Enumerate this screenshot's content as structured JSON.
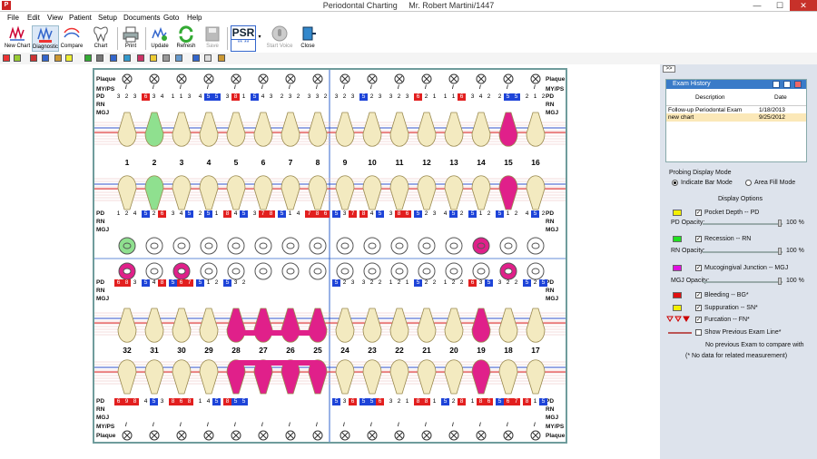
{
  "window": {
    "title": "Periodontal Charting",
    "patient": "Mr. Robert Martini/1447",
    "close_glyph": "✕",
    "min_glyph": "—",
    "max_glyph": "☐",
    "app_glyph": "P"
  },
  "menus": [
    "File",
    "Edit",
    "View",
    "Patient",
    "Setup",
    "Documents",
    "Goto",
    "Help"
  ],
  "toolbar": {
    "new_chart": "New Chart",
    "diagnostic": "Diagnostic",
    "compare": "Compare",
    "chart": "Chart",
    "print": "Print",
    "update": "Update",
    "refresh": "Refresh",
    "save": "Save",
    "psr": "PSR",
    "psr_marks": "** **",
    "start_voice": "Start Voice",
    "close": "Close"
  },
  "chart": {
    "row_labels": {
      "plaque": "Plaque",
      "myps": "MY/PS",
      "pd": "PD",
      "rn": "RN",
      "mgj": "MGJ"
    },
    "upper_teeth": [
      "1",
      "2",
      "3",
      "4",
      "5",
      "6",
      "7",
      "8",
      "9",
      "10",
      "11",
      "12",
      "13",
      "14",
      "15",
      "16"
    ],
    "lower_teeth": [
      "32",
      "31",
      "30",
      "29",
      "28",
      "27",
      "26",
      "25",
      "24",
      "23",
      "22",
      "21",
      "20",
      "19",
      "18",
      "17"
    ],
    "upper_buccal_pd": [
      "3",
      "2",
      "3",
      "6",
      "3",
      "4",
      "1",
      "1",
      "3",
      "4",
      "5",
      "5",
      "3",
      "8",
      "1",
      "5",
      "4",
      "3",
      "2",
      "3",
      "2",
      "3",
      "3",
      "2",
      "3",
      "2",
      "3",
      "5",
      "2",
      "3",
      "3",
      "2",
      "3",
      "6",
      "2",
      "1",
      "1",
      "1",
      "6",
      "3",
      "4",
      "2",
      "2",
      "5",
      "5",
      "2",
      "1",
      "2"
    ],
    "upper_lingual_pd": [
      "1",
      "2",
      "4",
      "5",
      "2",
      "6",
      "3",
      "4",
      "5",
      "2",
      "5",
      "1",
      "8",
      "4",
      "5",
      "3",
      "7",
      "8",
      "5",
      "1",
      "4",
      "7",
      "8",
      "6",
      "5",
      "3",
      "7",
      "8",
      "4",
      "5",
      "3",
      "8",
      "6",
      "5",
      "2",
      "3",
      "4",
      "5",
      "2",
      "5",
      "1",
      "2",
      "5",
      "1",
      "2",
      "4",
      "5",
      "2"
    ],
    "lower_lingual_pd": [
      "6",
      "8",
      "3",
      "5",
      "4",
      "8",
      "5",
      "6",
      "7",
      "5",
      "1",
      "2",
      "5",
      "3",
      "2",
      "",
      "",
      "",
      "",
      "",
      "",
      "",
      "",
      "",
      "5",
      "2",
      "3",
      "3",
      "2",
      "2",
      "1",
      "2",
      "1",
      "5",
      "2",
      "2",
      "1",
      "2",
      "2",
      "6",
      "3",
      "5",
      "3",
      "2",
      "2",
      "5",
      "2",
      "5"
    ],
    "lower_buccal_pd": [
      "6",
      "9",
      "8",
      "4",
      "5",
      "3",
      "8",
      "6",
      "8",
      "1",
      "4",
      "5",
      "8",
      "5",
      "5",
      "",
      "",
      "",
      "",
      "",
      "",
      "",
      "",
      "",
      "5",
      "3",
      "6",
      "5",
      "5",
      "6",
      "3",
      "2",
      "1",
      "8",
      "8",
      "1",
      "5",
      "2",
      "8",
      "1",
      "8",
      "6",
      "5",
      "6",
      "7",
      "8",
      "1",
      "5"
    ],
    "mark": "/"
  },
  "exam_history": {
    "title": "Exam History",
    "col_description": "Description",
    "col_date": "Date",
    "rows": [
      {
        "description": "Follow-up Periodontal Exam",
        "date": "1/18/2013"
      },
      {
        "description": "new chart",
        "date": "9/25/2012"
      }
    ]
  },
  "probing": {
    "title": "Probing Display Mode",
    "indicate_bar": "Indicate Bar Mode",
    "area_fill": "Area Fill Mode",
    "selected": "indicate_bar"
  },
  "display_options": {
    "title": "Display Options",
    "pocket_depth": "Pocket Depth -- PD",
    "pd_opacity": "PD Opacity:",
    "pd_opacity_val": "100 %",
    "recession": "Recession -- RN",
    "rn_opacity": "RN Opacity:",
    "rn_opacity_val": "100 %",
    "mgj": "Mucogingival Junction -- MGJ",
    "mgj_opacity": "MGJ Opacity:",
    "mgj_opacity_val": "100 %",
    "bleeding": "Bleeding -- BG*",
    "suppuration": "Suppuration -- SN*",
    "furcation": "Furcation -- FN*",
    "show_previous": "Show Previous Exam Line*",
    "no_previous": "No previous Exam to compare with",
    "no_data": "(* No data for related measurement)",
    "colors": {
      "pd": "#f4f000",
      "rn": "#21e021",
      "mgj": "#e010e0",
      "bleeding": "#e01010",
      "suppuration": "#f4f000"
    }
  },
  "collapse": ">>"
}
